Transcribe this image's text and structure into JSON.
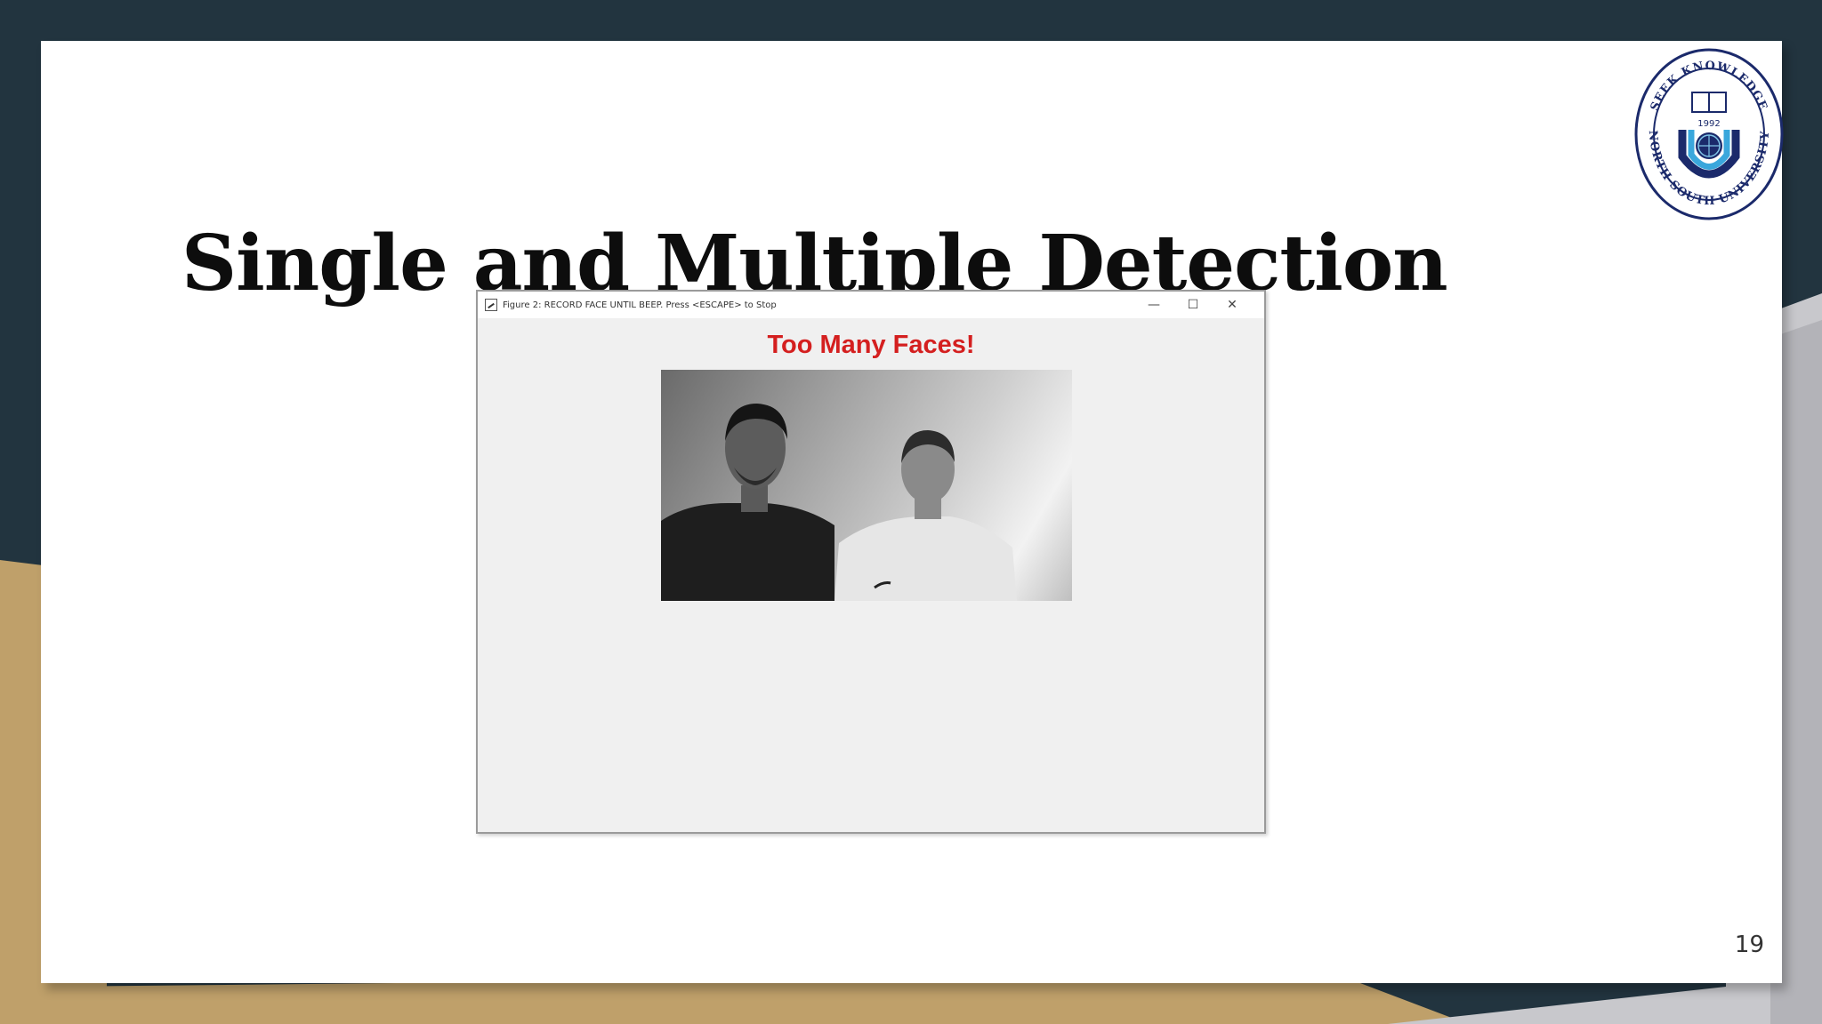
{
  "slide": {
    "title": "Single and Multiple Detection",
    "page_number": "19"
  },
  "logo": {
    "top_text": "SEEK KNOWLEDGE",
    "year": "1992",
    "bottom_text": "NORTH SOUTH UNIVERSITY"
  },
  "window": {
    "title": "Figure 2: RECORD FACE UNTIL BEEP. Press <ESCAPE> to Stop",
    "controls": {
      "minimize": "—",
      "maximize": "☐",
      "close": "✕"
    },
    "figure_label": "Too Many Faces!"
  },
  "colors": {
    "frame_dark": "#22343f",
    "frame_gold": "#bfa06a",
    "label_red": "#d41f1f"
  }
}
